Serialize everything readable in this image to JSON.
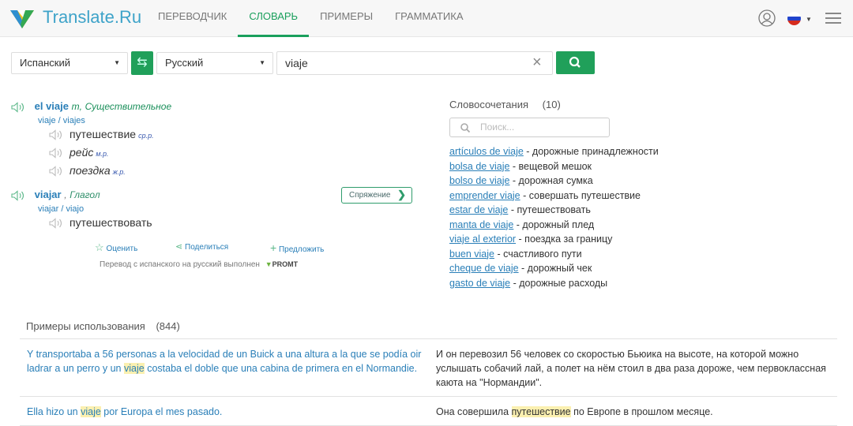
{
  "header": {
    "brand": "Translate.Ru",
    "nav": [
      {
        "label": "ПЕРЕВОДЧИК",
        "active": false
      },
      {
        "label": "СЛОВАРЬ",
        "active": true
      },
      {
        "label": "ПРИМЕРЫ",
        "active": false
      },
      {
        "label": "ГРАММАТИКА",
        "active": false
      }
    ],
    "icons": [
      "user-icon",
      "flag-ru-icon",
      "menu-icon"
    ]
  },
  "search_bar": {
    "source_lang": "Испанский",
    "target_lang": "Русский",
    "query": "viaje",
    "swap_icon": "swap-arrows-icon",
    "clear_icon": "close-icon",
    "search_icon": "search-icon"
  },
  "entries": [
    {
      "word": "el viaje",
      "gender": "m,",
      "pos": "Существительное",
      "forms": "viaje / viajes",
      "translations": [
        {
          "text": "путешествие",
          "gender": "ср.р.",
          "italic": false
        },
        {
          "text": "рейс",
          "gender": "м.р.",
          "italic": true
        },
        {
          "text": "поездка",
          "gender": "ж.р.",
          "italic": true
        }
      ]
    },
    {
      "word": "viajar",
      "gender": ",",
      "pos": "Глагол",
      "forms": "viajar / viajo",
      "conjugation_label": "Спряжение",
      "translations": [
        {
          "text": "путешествовать",
          "gender": "",
          "italic": false
        }
      ]
    }
  ],
  "actions": {
    "rate": "Оценить",
    "share": "Поделиться",
    "suggest": "Предложить"
  },
  "promt_credit": "Перевод с испанского на русский выполнен",
  "promt_logo": "PROMT",
  "collocations": {
    "title": "Словосочетания",
    "count": "(10)",
    "search_placeholder": "Поиск...",
    "items": [
      {
        "phrase": "artículos de viaje",
        "translation": " - дорожные принадлежности"
      },
      {
        "phrase": "bolsa de viaje",
        "translation": " - вещевой мешок"
      },
      {
        "phrase": "bolso de viaje",
        "translation": " - дорожная сумка"
      },
      {
        "phrase": "emprender viaje",
        "translation": " - совершать путешествие"
      },
      {
        "phrase": "estar de viaje",
        "translation": " - путешествовать"
      },
      {
        "phrase": "manta de viaje",
        "translation": " - дорожный плед"
      },
      {
        "phrase": "viaje al exterior",
        "translation": " - поездка за границу"
      },
      {
        "phrase": "buen viaje",
        "translation": " - счастливого пути"
      },
      {
        "phrase": "cheque de viaje",
        "translation": " - дорожный чек"
      },
      {
        "phrase": "gasto de viaje",
        "translation": " - дорожные расходы"
      }
    ]
  },
  "examples": {
    "title": "Примеры использования",
    "count": "(844)",
    "rows": [
      {
        "src_before": "Y transportaba a 56 personas a la velocidad de un Buick a una altura a la que se podía oir ladrar a un perro y un ",
        "src_hl": "viaje",
        "src_after": " costaba el doble que una cabina de primera en el Normandie.",
        "dst_before": "И он перевозил 56 человек со скоростью Бьюика на высоте, на которой можно услышать собачий лай, а полет на нём стоил в два раза дороже, чем первоклассная каюта на \"Нормандии\".",
        "dst_hl": "",
        "dst_after": ""
      },
      {
        "src_before": "Ella hizo un ",
        "src_hl": "viaje",
        "src_after": " por Europa el mes pasado.",
        "dst_before": "Она совершила ",
        "dst_hl": "путешествие",
        "dst_after": " по Европе в прошлом месяце."
      }
    ]
  }
}
